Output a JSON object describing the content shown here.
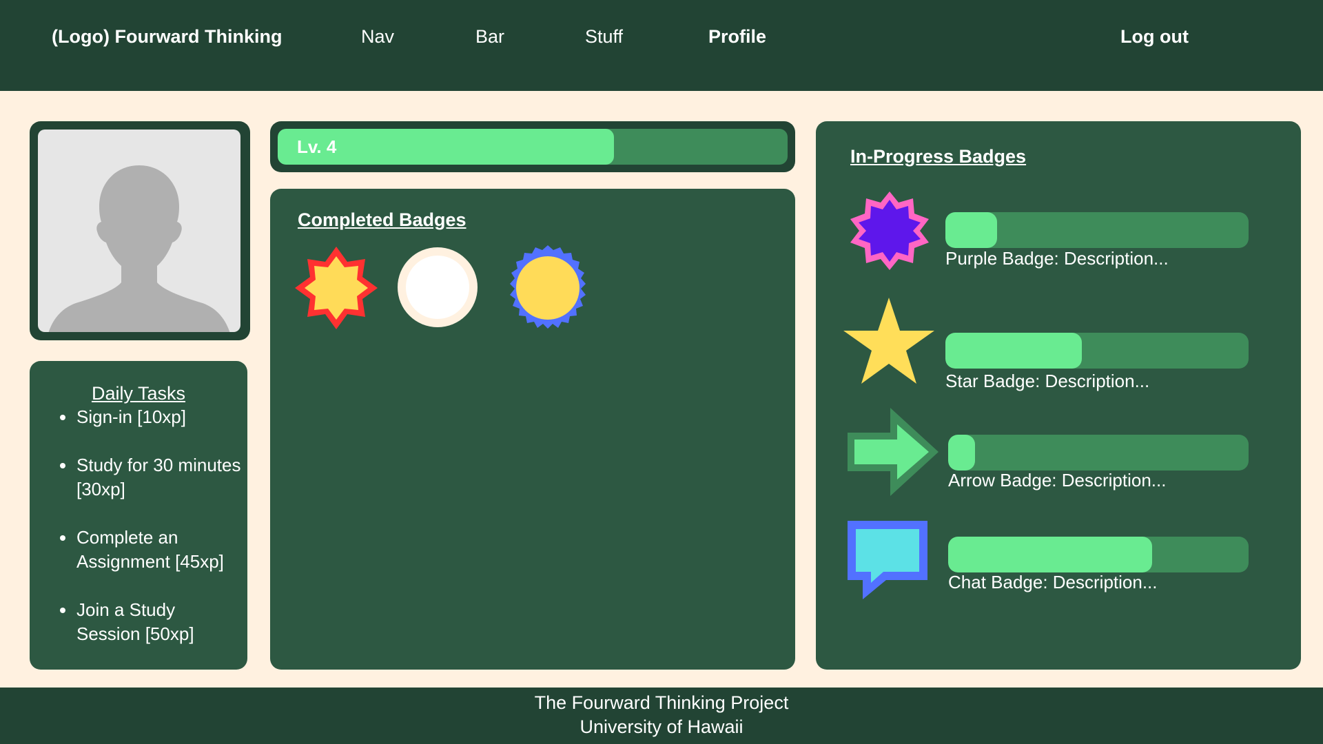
{
  "header": {
    "logo_text": "(Logo) Fourward Thinking",
    "nav": [
      "Nav",
      "Bar",
      "Stuff",
      "Profile"
    ],
    "logout_label": "Log out"
  },
  "avatar": {
    "icon": "user-silhouette-icon"
  },
  "daily_tasks": {
    "title": "Daily Tasks",
    "items": [
      "Sign-in [10xp]",
      "Study for 30 minutes [30xp]",
      "Complete an Assignment [45xp]",
      "Join a Study Session [50xp]"
    ]
  },
  "level": {
    "label": "Lv. 4",
    "progress": 0.66
  },
  "completed_badges": {
    "title": "Completed Badges",
    "badges": [
      {
        "icon": "red-yellow-starburst-badge-icon",
        "fill": "#ffdb58",
        "border": "#ff3131"
      },
      {
        "icon": "white-circle-badge-icon",
        "fill": "#ffffff",
        "border": "#fff1e0"
      },
      {
        "icon": "blue-yellow-sunburst-badge-icon",
        "fill": "#ffdb58",
        "border": "#5271ff"
      }
    ]
  },
  "in_progress_badges": {
    "title": "In-Progress Badges",
    "items": [
      {
        "icon": "purple-starburst-badge-icon",
        "description": "Purple Badge: Description...",
        "progress": 0.17,
        "fill": "#5e17eb",
        "border": "#ff66c4"
      },
      {
        "icon": "yellow-star-badge-icon",
        "description": "Star Badge: Description...",
        "progress": 0.45,
        "fill": "#ffde59"
      },
      {
        "icon": "green-arrow-badge-icon",
        "description": "Arrow Badge: Description...",
        "progress": 0.09,
        "fill": "#69eb91",
        "border": "#3e8c5a"
      },
      {
        "icon": "chat-bubble-badge-icon",
        "description": "Chat Badge: Description...",
        "progress": 0.68,
        "fill": "#5ce1e6",
        "border": "#5271ff"
      }
    ]
  },
  "footer": {
    "line1": "The Fourward Thinking Project",
    "line2": "University of Hawaii"
  },
  "colors": {
    "background": "#fff1e0",
    "dark_green": "#224434",
    "card_green": "#2d5842",
    "track_green": "#3e8c5a",
    "fill_green": "#69eb91"
  }
}
